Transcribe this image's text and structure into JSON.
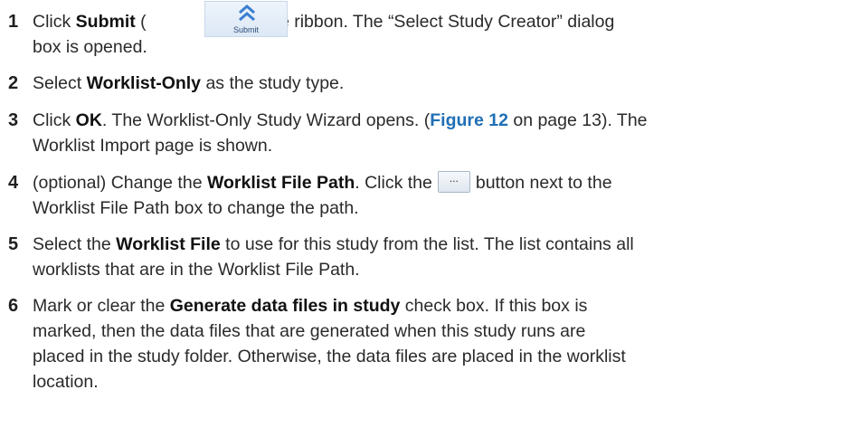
{
  "steps": [
    {
      "number": "1",
      "pre": "Click ",
      "bold": "Submit",
      "paren_open": " (",
      "icon": {
        "name": "submit-icon",
        "label": "Submit"
      },
      "post_line1": ") on the ribbon. The “Select Study Creator” dialog",
      "line2": "box is opened."
    },
    {
      "number": "2",
      "pre": "Select ",
      "bold": "Worklist-Only",
      "post": " as the study type."
    },
    {
      "number": "3",
      "pre": "Click ",
      "bold": "OK",
      "mid": ". The Worklist-Only Study Wizard opens. (",
      "link": "Figure 12",
      "post_line1": " on page 13). The",
      "line2": "Worklist Import page is shown."
    },
    {
      "number": "4",
      "pre": "(optional) Change the ",
      "bold": "Worklist File Path",
      "mid": ". Click the",
      "button_glyph": "...",
      "post_line1": "button next to the",
      "line2": "Worklist File Path box to change the path."
    },
    {
      "number": "5",
      "pre": "Select the ",
      "bold": "Worklist File",
      "post_line1": " to use for this study from the list. The list contains all",
      "line2": "worklists that are in the Worklist File Path."
    },
    {
      "number": "6",
      "pre": "Mark or clear the ",
      "bold": "Generate data files in study",
      "post_line1": " check box. If this box is",
      "line2": "marked, then the data files that are generated when this study runs are",
      "line3": "placed in the study folder. Otherwise, the data files are placed in the worklist",
      "line4": "location."
    }
  ],
  "colors": {
    "link": "#1f6fb5",
    "text": "#2a2a2a",
    "icon_arrow": "#3b7fd1"
  }
}
